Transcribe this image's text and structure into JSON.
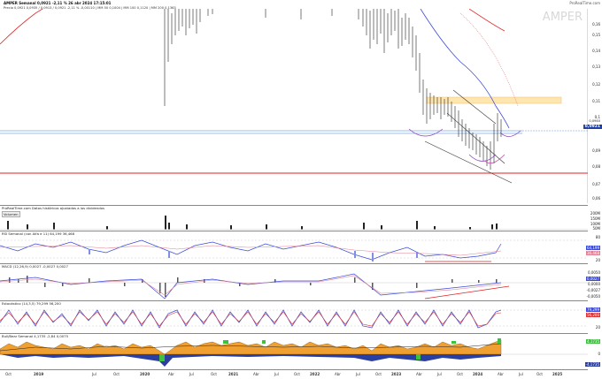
{
  "header": {
    "title": "AMPER Semanal 0,0921 -2,11 % 26 abr 2024 17:15:01",
    "legend": "Precio 0,0921 0,0935 / 0,0913 / 0,0921 -2,11 % -0,00110 | MM 50 0,1004 | MM 100 0,1120 | MM 200 0,1363"
  },
  "watermark": "AMPER",
  "site": "ProRealTime.com",
  "price_axis": {
    "ticks": [
      "0,16",
      "0,15",
      "0,14",
      "0,13",
      "0,12",
      "0,11",
      "0,1",
      "0,09",
      "0,08",
      "0,07",
      "0,06",
      "0,05"
    ],
    "last_price": "0,0921",
    "last_price_small": "0,0940"
  },
  "volume_panel": {
    "title": "ProRealTime.com Datos históricos ajustados a los dividendos",
    "label": "Volumen",
    "ticks": [
      "200M",
      "150M",
      "100M",
      "50M"
    ]
  },
  "rsi_panel": {
    "title": "RSI Semanal (con Alfa e 11) 64,199 36,468",
    "ticks": [
      "80",
      "64,199",
      "36,468",
      "20"
    ]
  },
  "macd_panel": {
    "title": "MACD (12,26,9) 0,0027 -0,0027 0,0027",
    "ticks": [
      "0,0050",
      "0,0027",
      "0,0000",
      "-0,0027",
      "-0,0050"
    ]
  },
  "stoch_panel": {
    "title": "Estocástico (14,3,5) 79,299 56,200",
    "ticks": [
      "79,299",
      "56,200",
      "20"
    ]
  },
  "bull_panel": {
    "title": "Bull/Bear Semanal 4,1735 -2,84 0,0075",
    "ticks": [
      "4,1735",
      "0",
      "-4,1735"
    ]
  },
  "x_axis": {
    "ticks": [
      "Oct",
      "2019",
      "Jul",
      "Oct",
      "2020",
      "Abr",
      "Jul",
      "Oct",
      "2021",
      "Abr",
      "Jul",
      "Oct",
      "2022",
      "Abr",
      "Jul",
      "Oct",
      "2023",
      "Abr",
      "Jul",
      "Oct",
      "2024",
      "Abr",
      "Jul",
      "Oct",
      "2025"
    ]
  },
  "colors": {
    "price": "#222222",
    "ma50": "#3b4bd8",
    "ma100": "#e03030",
    "ma200": "#e03030",
    "support": "#e02020",
    "resistance_zone": "#fde6b0",
    "rsi": "#3b4bd8",
    "macd_hist": "#555555",
    "stoch_k": "#3b4bd8",
    "stoch_d": "#e03030",
    "bull": "#f0a030",
    "bear": "#2a3fa0"
  }
}
